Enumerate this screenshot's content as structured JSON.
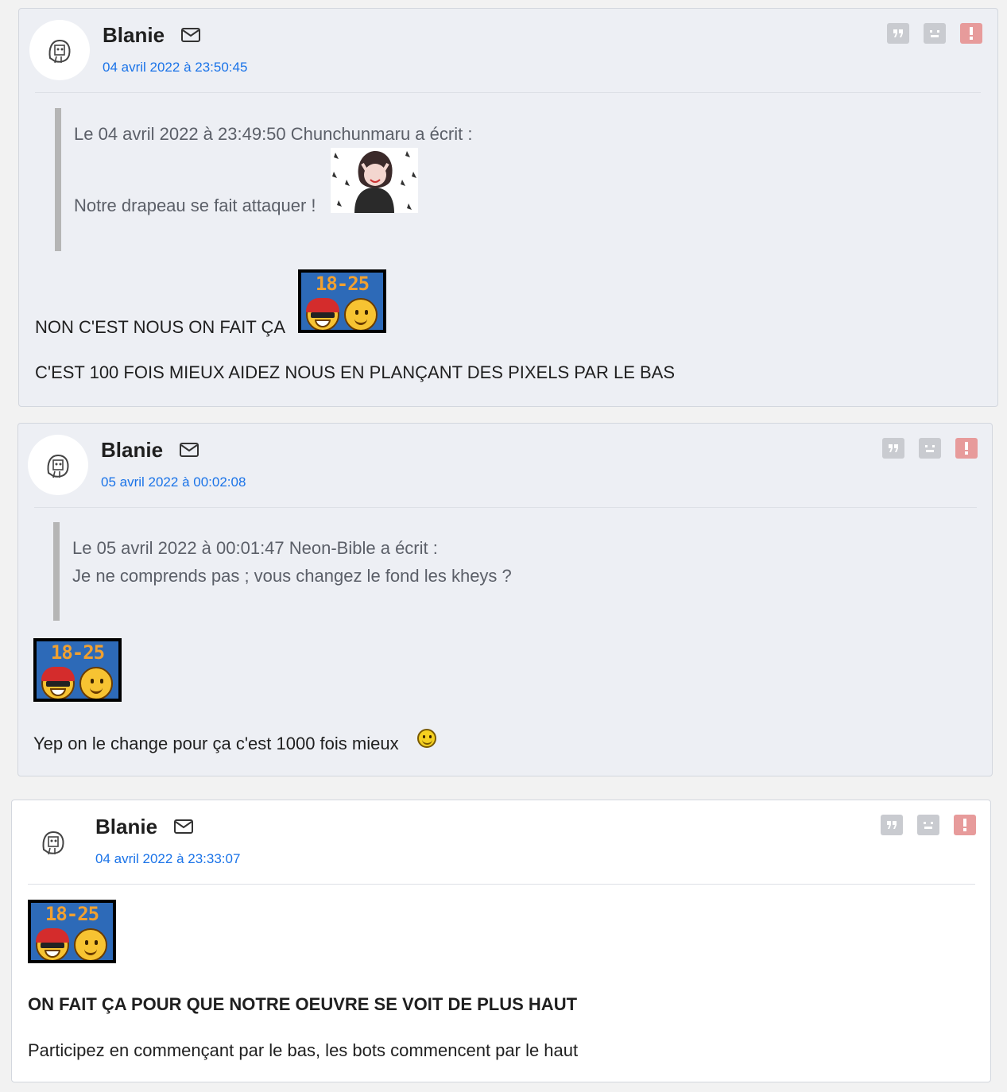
{
  "posts": [
    {
      "author": "Blanie",
      "date": "04 avril 2022 à 23:50:45",
      "quote": {
        "header": "Le 04 avril 2022 à 23:49:50 Chunchunmaru a écrit :",
        "lines": [
          "Notre drapeau se fait attaquer !"
        ]
      },
      "body": [
        "NON C'EST NOUS ON FAIT ÇA",
        "C'EST 100 FOIS MIEUX AIDEZ NOUS EN PLANÇANT DES PIXELS PAR LE BAS"
      ]
    },
    {
      "author": "Blanie",
      "date": "05 avril 2022 à 00:02:08",
      "quote": {
        "header": "Le 05 avril 2022 à 00:01:47 Neon-Bible a écrit :",
        "lines": [
          "Je ne comprends pas ; vous changez le fond les kheys ?"
        ]
      },
      "body": [
        "Yep on le change pour ça c'est 1000 fois mieux"
      ]
    },
    {
      "author": "Blanie",
      "date": "04 avril 2022 à 23:33:07",
      "body": [
        "ON FAIT ÇA POUR QUE NOTRE OEUVRE SE VOIT DE PLUS HAUT",
        "Participez en commençant par le bas, les bots commencent par le haut"
      ]
    }
  ],
  "sticker_text": "18-25",
  "icons": {
    "avatar": "owl-avatar-icon",
    "mail": "mail-icon",
    "quote": "quote-icon",
    "sad": "sad-face-icon",
    "report": "report-icon"
  },
  "colors": {
    "date": "#1a73e8",
    "report": "#e79b9b",
    "action": "#c9cbd0",
    "post_bg": "#edeff4"
  }
}
